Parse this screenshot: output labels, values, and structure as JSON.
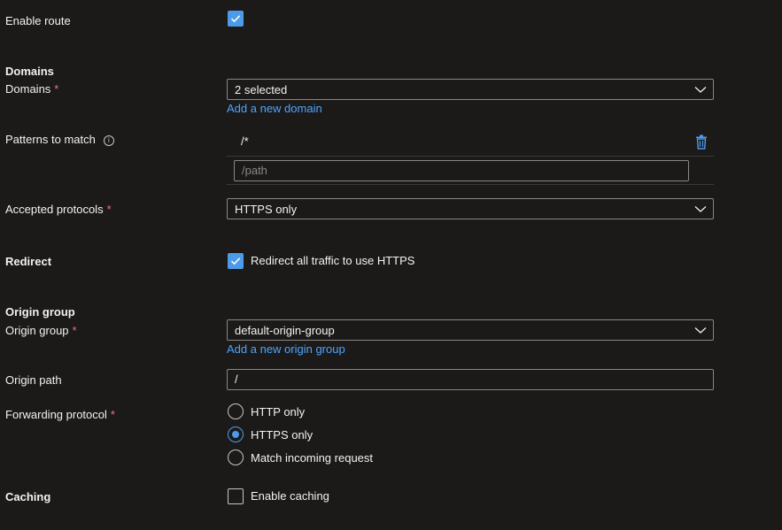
{
  "enable_route": {
    "label": "Enable route",
    "checked": true
  },
  "domains_section": {
    "title": "Domains"
  },
  "domains": {
    "label": "Domains",
    "required_mark": "*",
    "value": "2 selected",
    "add_link": "Add a new domain"
  },
  "patterns": {
    "label": "Patterns to match",
    "info_icon": "info-icon",
    "items": [
      "/*"
    ],
    "delete_icon": "trash-icon",
    "input_placeholder": "/path"
  },
  "accepted_protocols": {
    "label": "Accepted protocols",
    "required_mark": "*",
    "value": "HTTPS only"
  },
  "redirect": {
    "label": "Redirect",
    "checkbox_label": "Redirect all traffic to use HTTPS",
    "checked": true
  },
  "origin_group_section": {
    "title": "Origin group"
  },
  "origin_group": {
    "label": "Origin group",
    "required_mark": "*",
    "value": "default-origin-group",
    "add_link": "Add a new origin group"
  },
  "origin_path": {
    "label": "Origin path",
    "value": "/"
  },
  "forwarding_protocol": {
    "label": "Forwarding protocol",
    "required_mark": "*",
    "options": [
      "HTTP only",
      "HTTPS only",
      "Match incoming request"
    ],
    "selected": "HTTPS only"
  },
  "caching": {
    "label": "Caching",
    "checkbox_label": "Enable caching",
    "checked": false
  },
  "colors": {
    "background": "#1b1a19",
    "accent": "#4f9ae8",
    "link": "#4ea4ff",
    "required": "#f1707b"
  }
}
